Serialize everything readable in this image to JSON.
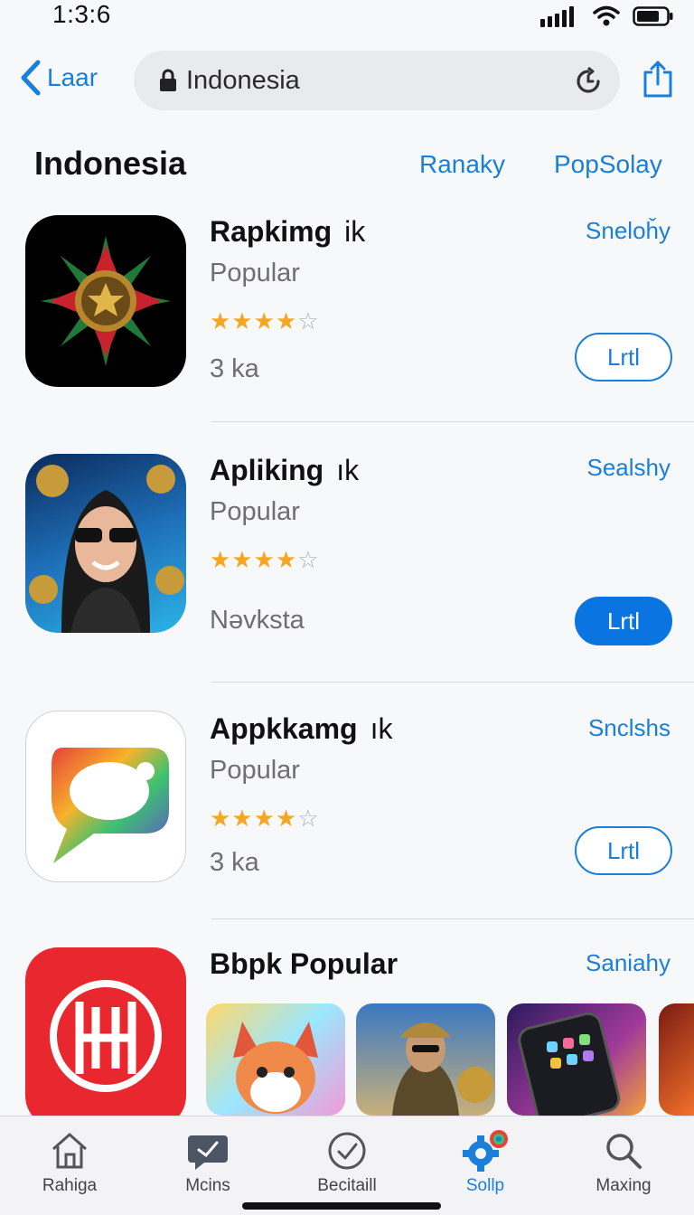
{
  "status": {
    "time": "1:3:6"
  },
  "nav": {
    "back_label": "Laar",
    "url": "Indonesia"
  },
  "header": {
    "title": "Indonesia",
    "link1": "Ranaky",
    "link2": "PopSolay"
  },
  "apps": [
    {
      "name": "Rapkimg",
      "suffix": "ik",
      "category": "Popular",
      "rating": 4,
      "meta": "3 ka",
      "side": "Sneloȟy",
      "button": "Lrtl"
    },
    {
      "name": "Apliking",
      "suffix": "ık",
      "category": "Popular",
      "rating": 4,
      "meta": "Nəvksta",
      "side": "Sealshy",
      "button": "Lrtl"
    },
    {
      "name": "Appkkamg",
      "suffix": "ık",
      "category": "Popular",
      "rating": 4,
      "meta": "3 ka",
      "side": "Snclshs",
      "button": "Lrtl"
    },
    {
      "name": "Bbpk Popular",
      "side": "Saniahy"
    }
  ],
  "tabs": [
    {
      "label": "Rahiga",
      "icon": "home-icon"
    },
    {
      "label": "Mcins",
      "icon": "chat-icon"
    },
    {
      "label": "Becitaill",
      "icon": "check-circle-icon"
    },
    {
      "label": "Sollp",
      "icon": "gear-icon"
    },
    {
      "label": "Maxing",
      "icon": "search-icon"
    }
  ],
  "colors": {
    "accent": "#1a7fd8",
    "star": "#f5a623"
  }
}
